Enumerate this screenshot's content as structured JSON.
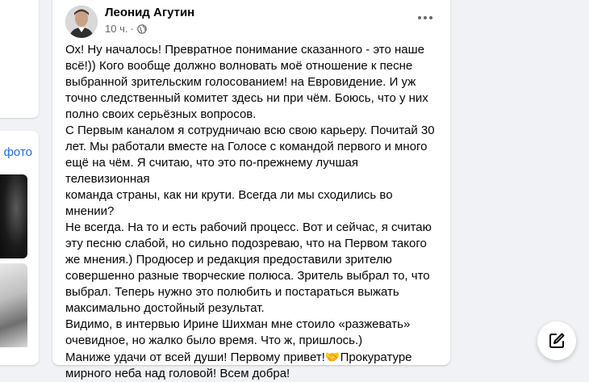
{
  "left": {
    "photo_link": "фото"
  },
  "post": {
    "author": "Леонид Агутин",
    "time": "10 ч.",
    "separator": "·",
    "text_lines": [
      "Ох! Ну началось! Превратное понимание сказанного - это наше",
      "всё!)) Кого вообще должно волновать моё отношение к песне",
      "выбранной зрительским голосованием! на Евровидение. И уж",
      "точно следственный комитет здесь ни при чём. Боюсь, что у них",
      "полно своих серьёзных вопросов.",
      "С Первым каналом я сотрудничаю всю свою карьеру. Почитай 30",
      "лет. Мы работали вместе на Голосе с командой первого и много",
      "ещё на чём. Я считаю, что это по-прежнему лучшая телевизионная",
      "команда страны, как ни крути. Всегда ли мы сходились во мнении?",
      "Не всегда. На то и есть рабочий процесс. Вот и сейчас, я считаю",
      "эту песню слабой, но сильно подозреваю, что на Первом такого",
      "же мнения.) Продюсер и редакция предоставили зрителю",
      "совершенно разные творческие полюса. Зритель выбрал то, что",
      "выбрал. Теперь нужно это полюбить и постараться выжать",
      "максимально достойный результат.",
      "Видимо, в интервью Ирине Шихман мне стоило «разжевать»",
      "очевидное, но жалко было время. Что ж, пришлось.)",
      "Маниже удачи от всей души! Первому привет!",
      "Прокуратуре",
      "мирного неба над головой! Всем добра!"
    ],
    "emoji": "🤝"
  },
  "icons": {
    "globe": "globe-icon",
    "more": "more-options-icon",
    "compose": "compose-icon"
  },
  "colors": {
    "link": "#216fdb",
    "meta": "#65676b",
    "page_bg": "#f0f2f5"
  }
}
